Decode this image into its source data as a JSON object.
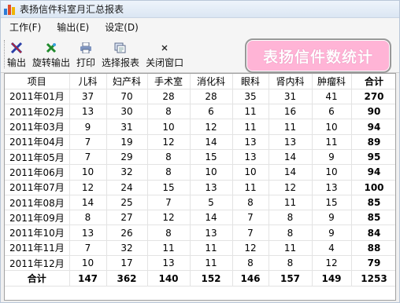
{
  "window": {
    "title": "表扬信件科室月汇总报表"
  },
  "menu": [
    "工作(F)",
    "输出(E)",
    "设定(D)"
  ],
  "toolbar": {
    "buttons": [
      {
        "label": "输出",
        "icon": "export-x-icon"
      },
      {
        "label": "旋转输出",
        "icon": "rotate-export-icon"
      },
      {
        "label": "打印",
        "icon": "printer-icon"
      },
      {
        "label": "选择报表",
        "icon": "select-report-icon"
      },
      {
        "label": "关闭窗口",
        "icon": "close-icon"
      }
    ]
  },
  "banner": {
    "text": "表扬信件数统计"
  },
  "table": {
    "headers": [
      "项目",
      "儿科",
      "妇产科",
      "手术室",
      "消化科",
      "眼科",
      "肾内科",
      "肿瘤科",
      "合计"
    ],
    "rows": [
      [
        "2011年01月",
        "37",
        "70",
        "28",
        "28",
        "35",
        "31",
        "41",
        "270"
      ],
      [
        "2011年02月",
        "13",
        "30",
        "8",
        "6",
        "11",
        "16",
        "6",
        "90"
      ],
      [
        "2011年03月",
        "9",
        "31",
        "10",
        "12",
        "11",
        "11",
        "10",
        "94"
      ],
      [
        "2011年04月",
        "7",
        "19",
        "12",
        "14",
        "13",
        "13",
        "11",
        "89"
      ],
      [
        "2011年05月",
        "7",
        "29",
        "8",
        "15",
        "13",
        "14",
        "9",
        "95"
      ],
      [
        "2011年06月",
        "10",
        "32",
        "8",
        "10",
        "10",
        "14",
        "10",
        "94"
      ],
      [
        "2011年07月",
        "12",
        "24",
        "15",
        "13",
        "11",
        "12",
        "13",
        "100"
      ],
      [
        "2011年08月",
        "14",
        "25",
        "7",
        "5",
        "8",
        "11",
        "15",
        "85"
      ],
      [
        "2011年09月",
        "8",
        "27",
        "12",
        "14",
        "7",
        "8",
        "9",
        "85"
      ],
      [
        "2011年10月",
        "13",
        "26",
        "8",
        "13",
        "7",
        "8",
        "9",
        "84"
      ],
      [
        "2011年11月",
        "7",
        "32",
        "11",
        "11",
        "12",
        "11",
        "4",
        "88"
      ],
      [
        "2011年12月",
        "10",
        "17",
        "13",
        "11",
        "8",
        "8",
        "12",
        "79"
      ]
    ],
    "total_row": [
      "合计",
      "147",
      "362",
      "140",
      "152",
      "146",
      "157",
      "149",
      "1253"
    ]
  }
}
